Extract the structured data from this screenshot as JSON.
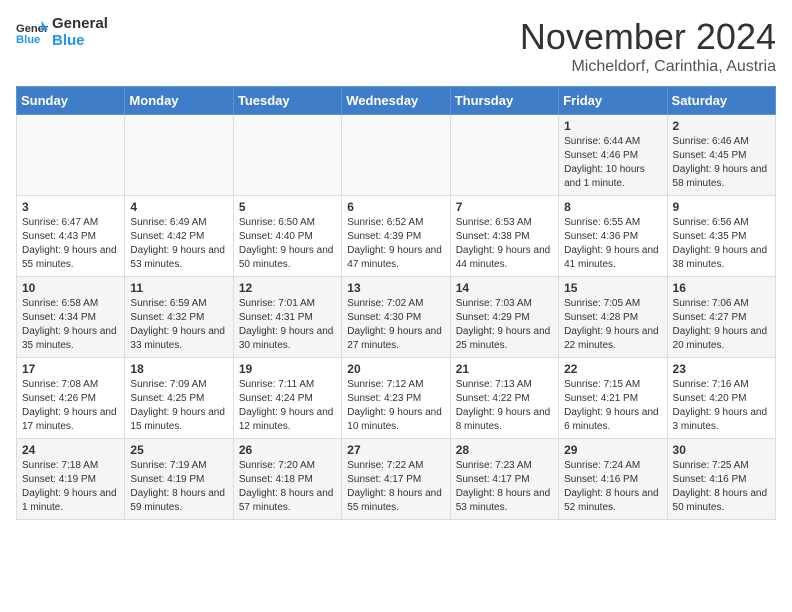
{
  "header": {
    "logo_general": "General",
    "logo_blue": "Blue",
    "title": "November 2024",
    "subtitle": "Micheldorf, Carinthia, Austria"
  },
  "weekdays": [
    "Sunday",
    "Monday",
    "Tuesday",
    "Wednesday",
    "Thursday",
    "Friday",
    "Saturday"
  ],
  "weeks": [
    [
      {
        "day": "",
        "info": ""
      },
      {
        "day": "",
        "info": ""
      },
      {
        "day": "",
        "info": ""
      },
      {
        "day": "",
        "info": ""
      },
      {
        "day": "",
        "info": ""
      },
      {
        "day": "1",
        "info": "Sunrise: 6:44 AM\nSunset: 4:46 PM\nDaylight: 10 hours and 1 minute."
      },
      {
        "day": "2",
        "info": "Sunrise: 6:46 AM\nSunset: 4:45 PM\nDaylight: 9 hours and 58 minutes."
      }
    ],
    [
      {
        "day": "3",
        "info": "Sunrise: 6:47 AM\nSunset: 4:43 PM\nDaylight: 9 hours and 55 minutes."
      },
      {
        "day": "4",
        "info": "Sunrise: 6:49 AM\nSunset: 4:42 PM\nDaylight: 9 hours and 53 minutes."
      },
      {
        "day": "5",
        "info": "Sunrise: 6:50 AM\nSunset: 4:40 PM\nDaylight: 9 hours and 50 minutes."
      },
      {
        "day": "6",
        "info": "Sunrise: 6:52 AM\nSunset: 4:39 PM\nDaylight: 9 hours and 47 minutes."
      },
      {
        "day": "7",
        "info": "Sunrise: 6:53 AM\nSunset: 4:38 PM\nDaylight: 9 hours and 44 minutes."
      },
      {
        "day": "8",
        "info": "Sunrise: 6:55 AM\nSunset: 4:36 PM\nDaylight: 9 hours and 41 minutes."
      },
      {
        "day": "9",
        "info": "Sunrise: 6:56 AM\nSunset: 4:35 PM\nDaylight: 9 hours and 38 minutes."
      }
    ],
    [
      {
        "day": "10",
        "info": "Sunrise: 6:58 AM\nSunset: 4:34 PM\nDaylight: 9 hours and 35 minutes."
      },
      {
        "day": "11",
        "info": "Sunrise: 6:59 AM\nSunset: 4:32 PM\nDaylight: 9 hours and 33 minutes."
      },
      {
        "day": "12",
        "info": "Sunrise: 7:01 AM\nSunset: 4:31 PM\nDaylight: 9 hours and 30 minutes."
      },
      {
        "day": "13",
        "info": "Sunrise: 7:02 AM\nSunset: 4:30 PM\nDaylight: 9 hours and 27 minutes."
      },
      {
        "day": "14",
        "info": "Sunrise: 7:03 AM\nSunset: 4:29 PM\nDaylight: 9 hours and 25 minutes."
      },
      {
        "day": "15",
        "info": "Sunrise: 7:05 AM\nSunset: 4:28 PM\nDaylight: 9 hours and 22 minutes."
      },
      {
        "day": "16",
        "info": "Sunrise: 7:06 AM\nSunset: 4:27 PM\nDaylight: 9 hours and 20 minutes."
      }
    ],
    [
      {
        "day": "17",
        "info": "Sunrise: 7:08 AM\nSunset: 4:26 PM\nDaylight: 9 hours and 17 minutes."
      },
      {
        "day": "18",
        "info": "Sunrise: 7:09 AM\nSunset: 4:25 PM\nDaylight: 9 hours and 15 minutes."
      },
      {
        "day": "19",
        "info": "Sunrise: 7:11 AM\nSunset: 4:24 PM\nDaylight: 9 hours and 12 minutes."
      },
      {
        "day": "20",
        "info": "Sunrise: 7:12 AM\nSunset: 4:23 PM\nDaylight: 9 hours and 10 minutes."
      },
      {
        "day": "21",
        "info": "Sunrise: 7:13 AM\nSunset: 4:22 PM\nDaylight: 9 hours and 8 minutes."
      },
      {
        "day": "22",
        "info": "Sunrise: 7:15 AM\nSunset: 4:21 PM\nDaylight: 9 hours and 6 minutes."
      },
      {
        "day": "23",
        "info": "Sunrise: 7:16 AM\nSunset: 4:20 PM\nDaylight: 9 hours and 3 minutes."
      }
    ],
    [
      {
        "day": "24",
        "info": "Sunrise: 7:18 AM\nSunset: 4:19 PM\nDaylight: 9 hours and 1 minute."
      },
      {
        "day": "25",
        "info": "Sunrise: 7:19 AM\nSunset: 4:19 PM\nDaylight: 8 hours and 59 minutes."
      },
      {
        "day": "26",
        "info": "Sunrise: 7:20 AM\nSunset: 4:18 PM\nDaylight: 8 hours and 57 minutes."
      },
      {
        "day": "27",
        "info": "Sunrise: 7:22 AM\nSunset: 4:17 PM\nDaylight: 8 hours and 55 minutes."
      },
      {
        "day": "28",
        "info": "Sunrise: 7:23 AM\nSunset: 4:17 PM\nDaylight: 8 hours and 53 minutes."
      },
      {
        "day": "29",
        "info": "Sunrise: 7:24 AM\nSunset: 4:16 PM\nDaylight: 8 hours and 52 minutes."
      },
      {
        "day": "30",
        "info": "Sunrise: 7:25 AM\nSunset: 4:16 PM\nDaylight: 8 hours and 50 minutes."
      }
    ]
  ]
}
